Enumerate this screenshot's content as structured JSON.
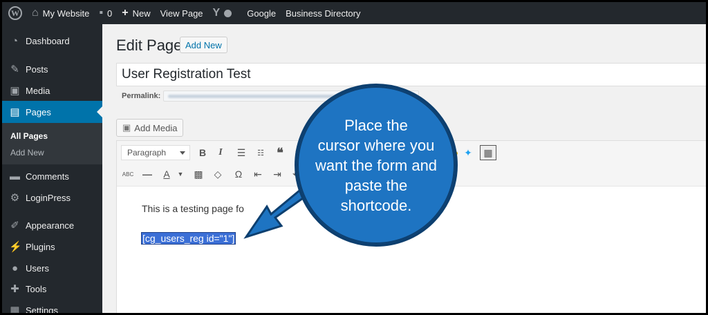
{
  "adminbar": {
    "site_name": "My Website",
    "comments_count": "0",
    "new_label": "New",
    "view_page": "View Page",
    "google": "Google",
    "business_directory": "Business Directory"
  },
  "sidebar": {
    "items": [
      {
        "label": "Dashboard",
        "icon": "dashboard-icon"
      },
      {
        "label": "Posts",
        "icon": "pin-icon"
      },
      {
        "label": "Media",
        "icon": "media-icon"
      },
      {
        "label": "Pages",
        "icon": "pages-icon"
      },
      {
        "label": "Comments",
        "icon": "comment-icon"
      },
      {
        "label": "LoginPress",
        "icon": "gear-icon"
      },
      {
        "label": "Appearance",
        "icon": "brush-icon"
      },
      {
        "label": "Plugins",
        "icon": "plug-icon"
      },
      {
        "label": "Users",
        "icon": "user-icon"
      },
      {
        "label": "Tools",
        "icon": "wrench-icon"
      },
      {
        "label": "Settings",
        "icon": "settings-icon"
      }
    ],
    "submenu": [
      "All Pages",
      "Add New"
    ]
  },
  "main": {
    "page_title": "Edit Page",
    "add_new": "Add New",
    "post_title": "User Registration Test",
    "permalink_label": "Permalink:",
    "add_media": "Add Media",
    "format_select": "Paragraph",
    "content_line": "This is a testing page fo",
    "shortcode": "[cg_users_reg id=\"1\"]"
  },
  "callout": {
    "text": "Place the\ncursor where you\nwant the form and\npaste the\nshortcode.",
    "color": "#1e74c2"
  },
  "colors": {
    "admin_bg": "#23282d",
    "active_menu": "#0073aa",
    "link": "#0073aa"
  }
}
